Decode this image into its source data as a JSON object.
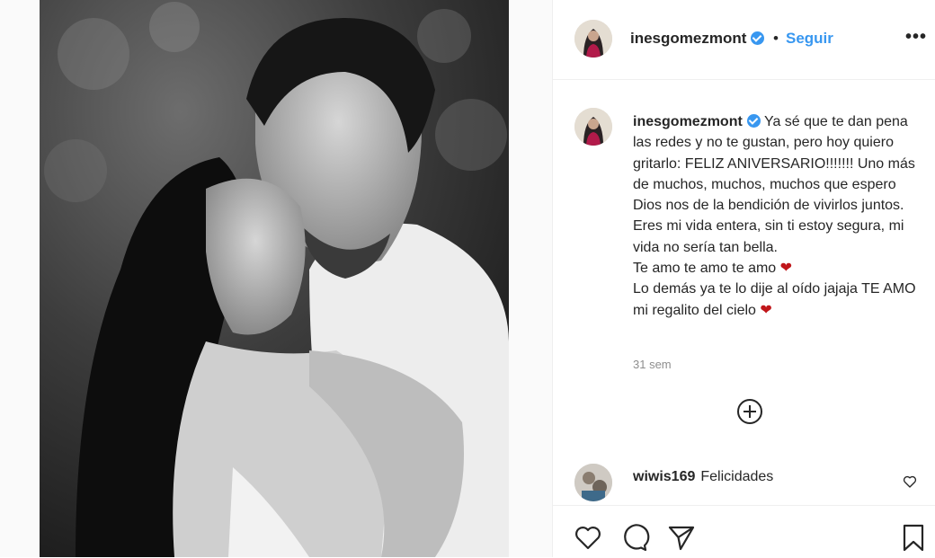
{
  "post": {
    "author": "inesgomezmont",
    "follow_label": "Seguir",
    "separator": "•",
    "more_label": "•••",
    "caption": [
      "Ya sé que te dan pena las redes y no te gustan, pero hoy quiero gritarlo: FELIZ ANIVERSARIO!!!!!!! Uno más de muchos, muchos, muchos que espero Dios nos de la bendición de vivirlos juntos.",
      "Eres mi vida entera, sin ti estoy segura, mi vida no sería tan bella.",
      "Te amo te amo te amo",
      "Lo demás ya te lo dije al oído jajaja TE AMO mi regalito del cielo"
    ],
    "time": "31 sem"
  },
  "comment": {
    "author": "wiwis169",
    "text": "Felicidades"
  },
  "icons": {
    "verified": "verified-badge-icon",
    "heart": "heart-emoji-icon",
    "load_more": "plus-circle-icon",
    "like": "heart-outline-icon",
    "comment": "comment-bubble-icon",
    "share": "paper-plane-icon",
    "save": "bookmark-icon"
  },
  "colors": {
    "link": "#3897f0",
    "text": "#262626",
    "muted": "#8e8e8e",
    "heart_emoji": "#c0161a"
  }
}
